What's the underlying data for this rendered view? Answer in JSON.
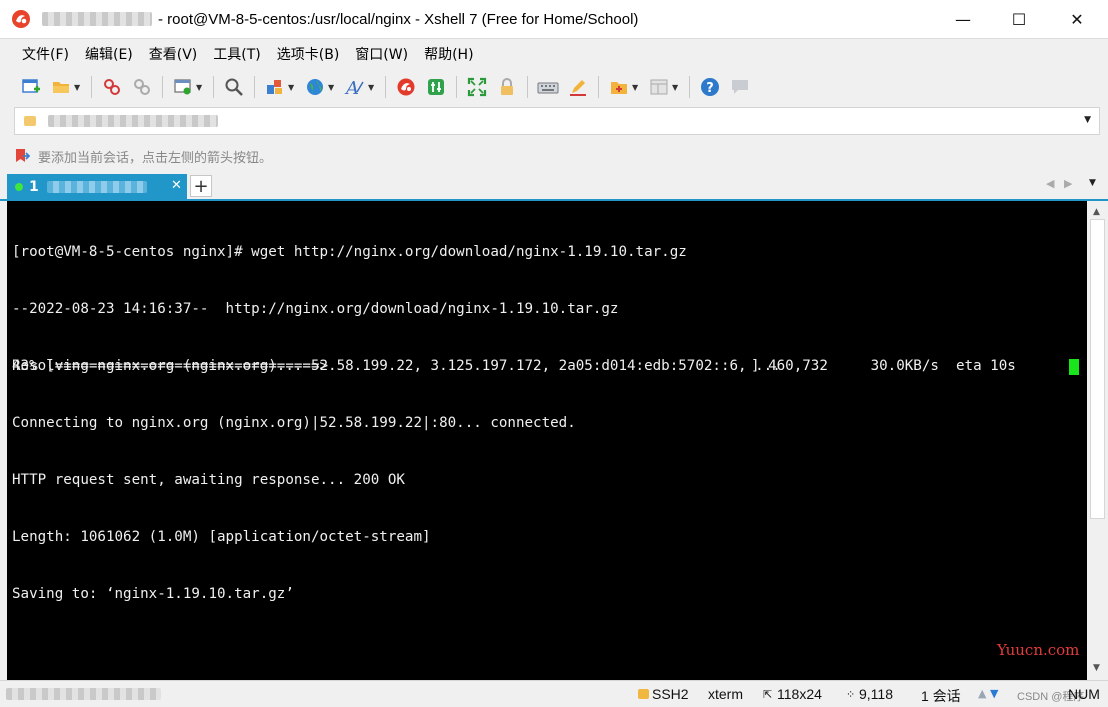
{
  "window": {
    "title": "- root@VM-8-5-centos:/usr/local/nginx - Xshell 7 (Free for Home/School)",
    "controls": {
      "minimize": "—",
      "maximize": "☐",
      "close": "✕"
    }
  },
  "menu": [
    "文件(F)",
    "编辑(E)",
    "查看(V)",
    "工具(T)",
    "选项卡(B)",
    "窗口(W)",
    "帮助(H)"
  ],
  "toolbar_icons": [
    "new-session-icon",
    "open-folder-icon",
    "connect-icon",
    "disconnect-icon",
    "properties-icon",
    "search-icon",
    "transfer-icon",
    "globe-icon",
    "font-icon",
    "xshell-icon",
    "xftp-icon",
    "fullscreen-icon",
    "lock-icon",
    "keyboard-icon",
    "compose-icon",
    "add-tab-icon",
    "layout-icon",
    "help-icon",
    "chat-icon"
  ],
  "hint": {
    "text": "要添加当前会话，点击左侧的箭头按钮。"
  },
  "tab": {
    "number": "1",
    "close": "✕",
    "add": "+"
  },
  "terminal": {
    "lines": [
      "[root@VM-8-5-centos nginx]# wget http://nginx.org/download/nginx-1.19.10.tar.gz",
      "--2022-08-23 14:16:37--  http://nginx.org/download/nginx-1.19.10.tar.gz",
      "Resolving nginx.org (nginx.org)... 52.58.199.22, 3.125.197.172, 2a05:d014:edb:5702::6, ...",
      "Connecting to nginx.org (nginx.org)|52.58.199.22|:80... connected.",
      "HTTP request sent, awaiting response... 200 OK",
      "Length: 1061062 (1.0M) [application/octet-stream]",
      "Saving to: ‘nginx-1.19.10.tar.gz’"
    ],
    "progress_left": "43% [===============================>",
    "progress_right": "] 460,732     30.0KB/s  eta 10s",
    "progress_percent": 43,
    "cursor_color": "#19e61a"
  },
  "watermark": "Yuucn.com",
  "status": {
    "protocol": "SSH2",
    "terminal_type": "xterm",
    "size": "118x24",
    "position": "9,118",
    "sessions": "1 会话",
    "num": "NUM",
    "csdn": "CSDN @程序"
  },
  "colors": {
    "tab_active": "#2196c8",
    "terminal_bg": "#000000",
    "cursor": "#19e61a",
    "watermark": "#e23b3b"
  }
}
